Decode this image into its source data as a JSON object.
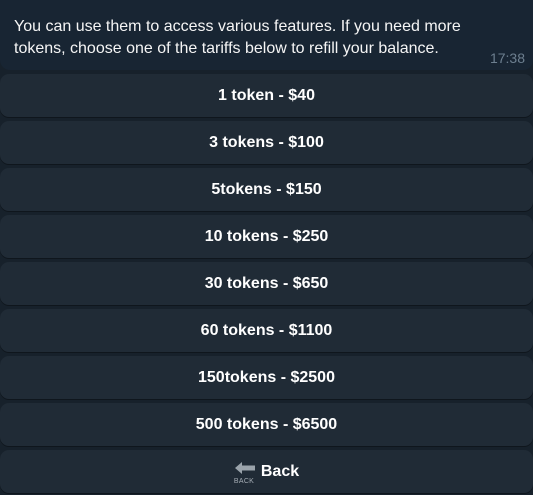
{
  "message": {
    "text": "You can use them to access various features. If you need more tokens, choose one of the tariffs below to refill your balance.",
    "time": "17:38"
  },
  "keyboard": {
    "buttons": [
      {
        "label": "1 token - $40"
      },
      {
        "label": "3 tokens - $100"
      },
      {
        "label": "5tokens - $150"
      },
      {
        "label": "10 tokens - $250"
      },
      {
        "label": "30 tokens - $650"
      },
      {
        "label": "60 tokens - $1100"
      },
      {
        "label": "150tokens - $2500"
      },
      {
        "label": "500 tokens - $6500"
      }
    ],
    "back": {
      "icon": "back-arrow-icon",
      "icon_caption": "BACK",
      "label": "Back"
    }
  }
}
